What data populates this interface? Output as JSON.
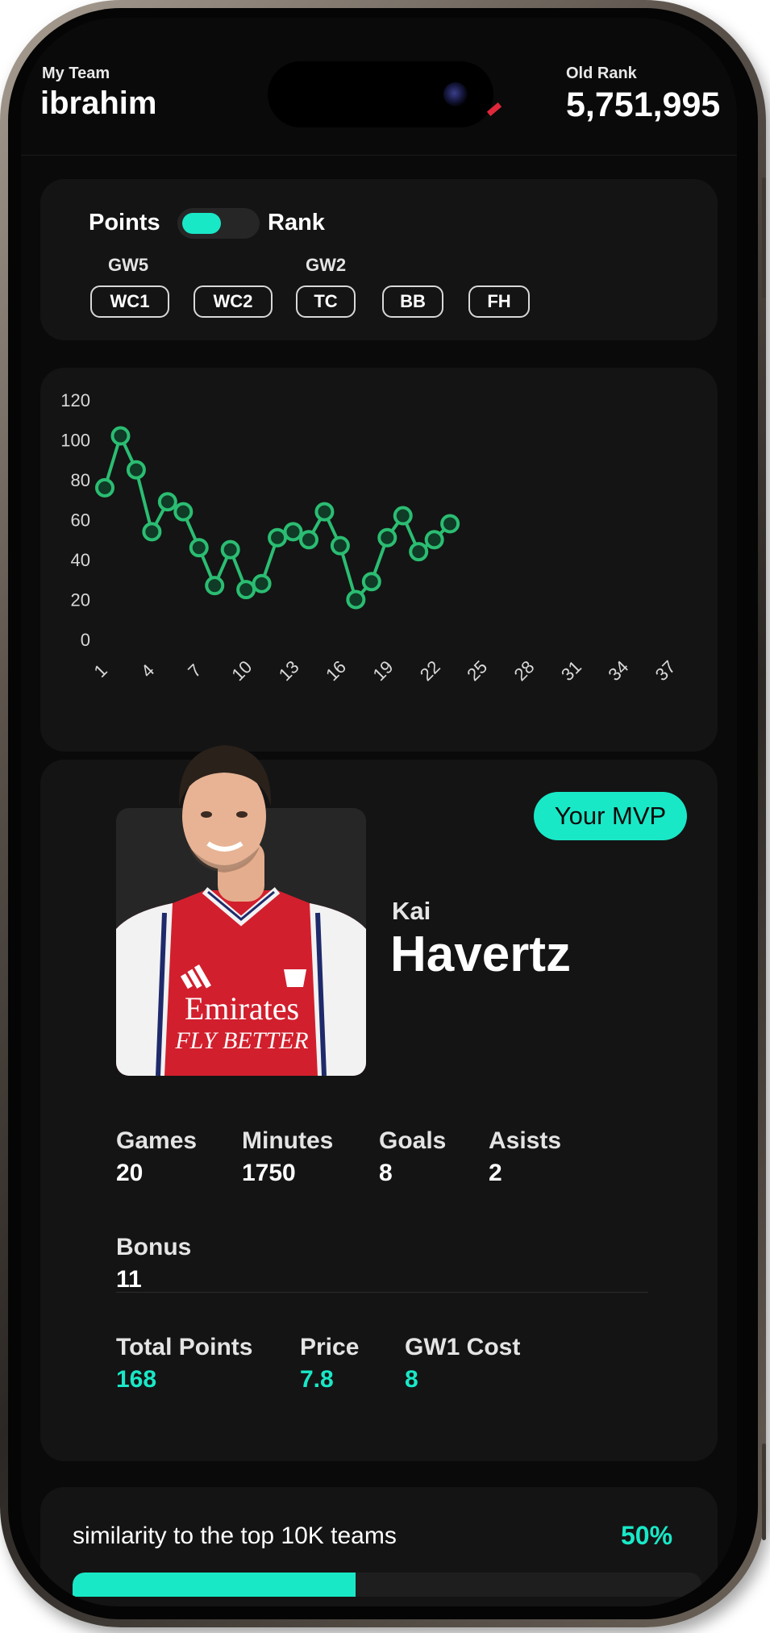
{
  "header": {
    "team_label": "My Team",
    "team_name": "ibrahim",
    "rank_label": "Old Rank",
    "rank_value": "5,751,995"
  },
  "toggle": {
    "left_label": "Points",
    "right_label": "Rank",
    "selected": "Points"
  },
  "chips": [
    {
      "label": "WC1",
      "note": "GW5"
    },
    {
      "label": "WC2",
      "note": ""
    },
    {
      "label": "TC",
      "note": "GW2"
    },
    {
      "label": "BB",
      "note": ""
    },
    {
      "label": "FH",
      "note": ""
    }
  ],
  "chart_data": {
    "type": "line",
    "x": [
      1,
      2,
      3,
      4,
      5,
      6,
      7,
      8,
      9,
      10,
      11,
      12,
      13,
      14,
      15,
      16,
      17,
      18,
      19,
      20,
      21,
      22,
      23,
      24
    ],
    "values": [
      76,
      102,
      85,
      54,
      69,
      64,
      46,
      27,
      45,
      25,
      28,
      51,
      54,
      50,
      64,
      47,
      20,
      29,
      51,
      62,
      44,
      50,
      58
    ],
    "x_values": [
      1,
      2,
      3,
      4,
      5,
      6,
      7,
      8,
      9,
      10,
      11,
      12,
      13,
      14,
      15,
      16,
      17,
      18,
      19,
      20,
      21,
      22,
      23
    ],
    "x_ticks": [
      "1",
      "4",
      "7",
      "10",
      "13",
      "16",
      "19",
      "22",
      "25",
      "28",
      "31",
      "34",
      "37"
    ],
    "y_ticks": [
      "0",
      "20",
      "40",
      "60",
      "80",
      "100",
      "120"
    ],
    "ylim": [
      0,
      120
    ],
    "xlim": [
      1,
      38
    ],
    "grid": false,
    "line_color": "#2bbd72"
  },
  "mvp": {
    "badge": "Your MVP",
    "first_name": "Kai",
    "last_name": "Havertz",
    "sponsor_line1": "Emirates",
    "sponsor_line2": "FLY BETTER"
  },
  "stats": {
    "games_label": "Games",
    "games": "20",
    "minutes_label": "Minutes",
    "minutes": "1750",
    "goals_label": "Goals",
    "goals": "8",
    "assists_label": "Asists",
    "assists": "2",
    "bonus_label": "Bonus",
    "bonus": "11",
    "total_points_label": "Total Points",
    "total_points": "168",
    "price_label": "Price",
    "price": "7.8",
    "gw1_cost_label": "GW1 Cost",
    "gw1_cost": "8"
  },
  "similarity": {
    "label": "similarity to the top 10K teams",
    "percent_text": "50%",
    "fraction": 0.45
  },
  "colors": {
    "accent": "#19e8c7",
    "card": "#141414",
    "background": "#0a0a0a"
  }
}
